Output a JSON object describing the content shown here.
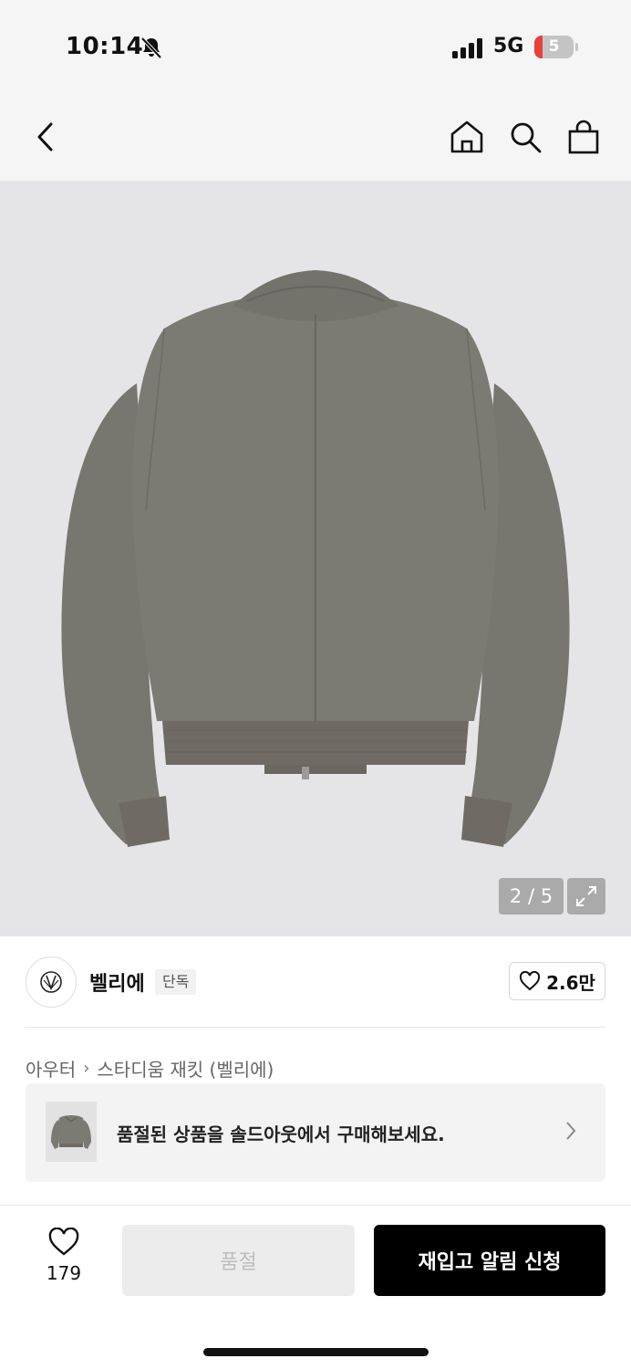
{
  "status_bar": {
    "time": "10:14",
    "network": "5G",
    "battery_level": "5",
    "battery_fraction": 0.05,
    "battery_color": "#e8403a"
  },
  "nav": {
    "icons": [
      "back-icon",
      "home-icon",
      "search-icon",
      "shopping-bag-icon"
    ]
  },
  "product_image": {
    "pager": "2 / 5",
    "current_index": 2,
    "total": 5,
    "jacket_color": "#7a7a73"
  },
  "brand": {
    "name": "벨리에",
    "badge": "단독",
    "likes": "2.6만"
  },
  "breadcrumb": {
    "category": "아우터",
    "separator": "›",
    "product": "스타디움 재킷 (벨리에)"
  },
  "soldout_banner": {
    "text": "품절된 상품을 솔드아웃에서 구매해보세요."
  },
  "bottom_bar": {
    "wish_count": "179",
    "soldout_label": "품절",
    "restock_label": "재입고 알림 신청"
  }
}
